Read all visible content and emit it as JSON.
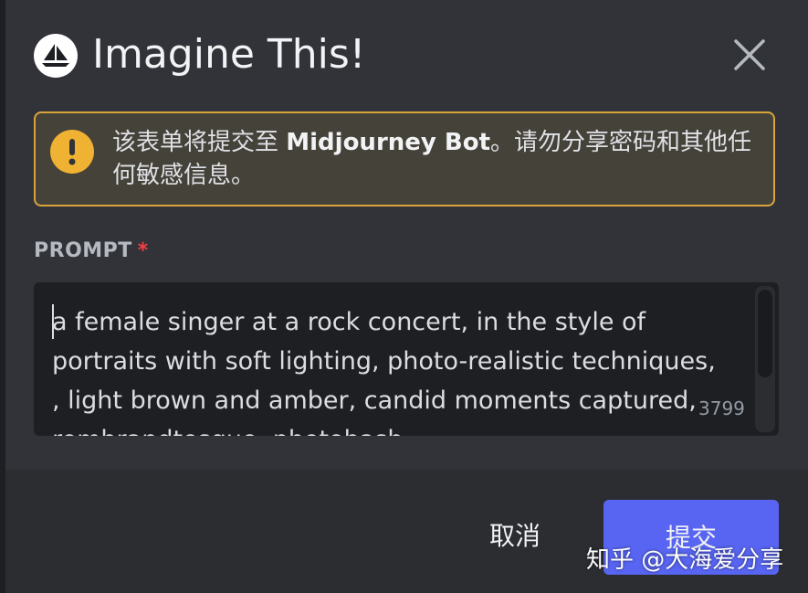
{
  "header": {
    "app_icon": "sailboat-logo",
    "title": "Imagine This!",
    "close_icon": "close-icon"
  },
  "warning": {
    "icon": "exclamation-icon",
    "text_before": "该表单将提交至 ",
    "bot_name": "Midjourney Bot",
    "text_after": "。请勿分享密码和其他任何敏感信息。"
  },
  "prompt_field": {
    "label": "PROMPT",
    "required_marker": "*",
    "value": "a female singer at a rock concert, in the style of portraits with soft lighting, photo-realistic techniques, , light brown and amber, candid moments captured, rembrandtesque, photobash",
    "remaining_chars": "3799"
  },
  "footer": {
    "cancel_label": "取消",
    "submit_label": "提交"
  },
  "watermark": "知乎 @大海爱分享",
  "colors": {
    "modal_bg": "#313338",
    "footer_bg": "#2b2d31",
    "warning_border": "#d9a43a",
    "submit_bg": "#5865f2",
    "required": "#f23f43"
  }
}
